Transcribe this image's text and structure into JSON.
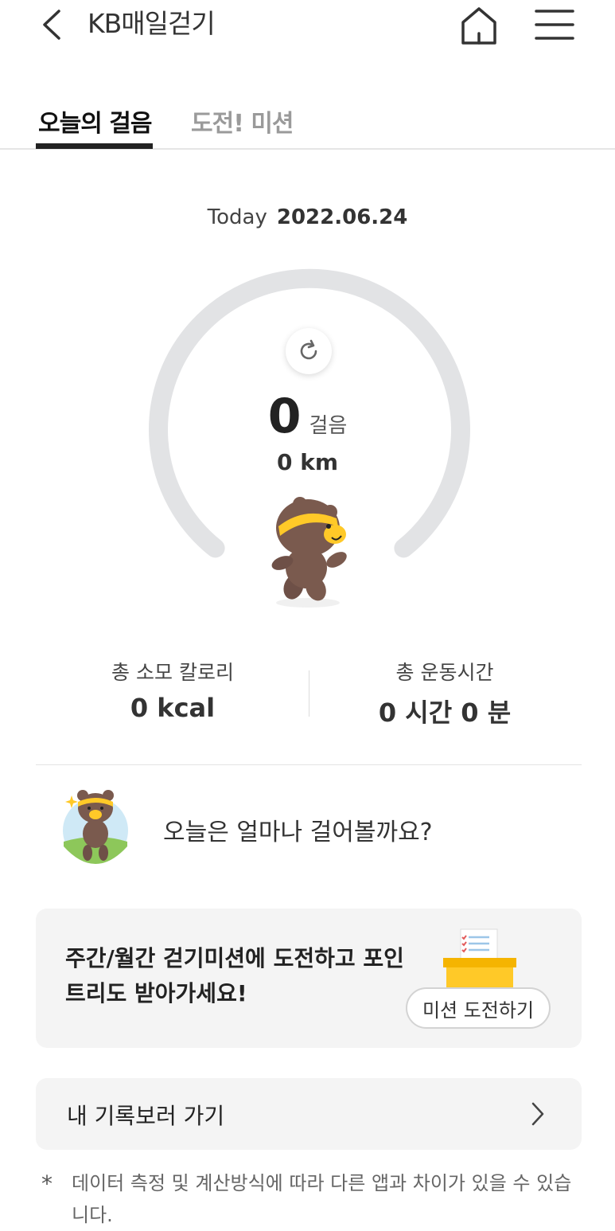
{
  "header": {
    "title": "KB매일걷기",
    "icons": [
      "chevron-left-icon",
      "home-icon",
      "hamburger-menu-icon"
    ]
  },
  "tabs": [
    {
      "label": "오늘의 걸음",
      "active": true
    },
    {
      "label": "도전! 미션",
      "active": false
    }
  ],
  "date": {
    "prefix": "Today",
    "value": "2022.06.24"
  },
  "gauge": {
    "steps": "0",
    "steps_unit": "걸음",
    "distance": "0 km",
    "progress": 0
  },
  "stats": {
    "calories_label": "총 소모 칼로리",
    "calories_value": "0 kcal",
    "time_label": "총 운동시간",
    "time_value": "0 시간 0 분"
  },
  "greeting": "오늘은 얼마나 걸어볼까요?",
  "mission": {
    "text": "주간/월간 걷기미션에 도전하고 포인트리도 받아가세요!",
    "button": "미션 도전하기"
  },
  "record": {
    "label": "내 기록보러 가기"
  },
  "footnote": {
    "marker": "*",
    "text": "데이터 측정 및 계산방식에 따라 다른 앱과 차이가 있을 수 있습니다."
  },
  "colors": {
    "accent_yellow": "#ffc928",
    "bear_brown": "#7a5a4e",
    "gauge_track": "#e2e3e5",
    "card_bg": "#f4f4f4"
  }
}
